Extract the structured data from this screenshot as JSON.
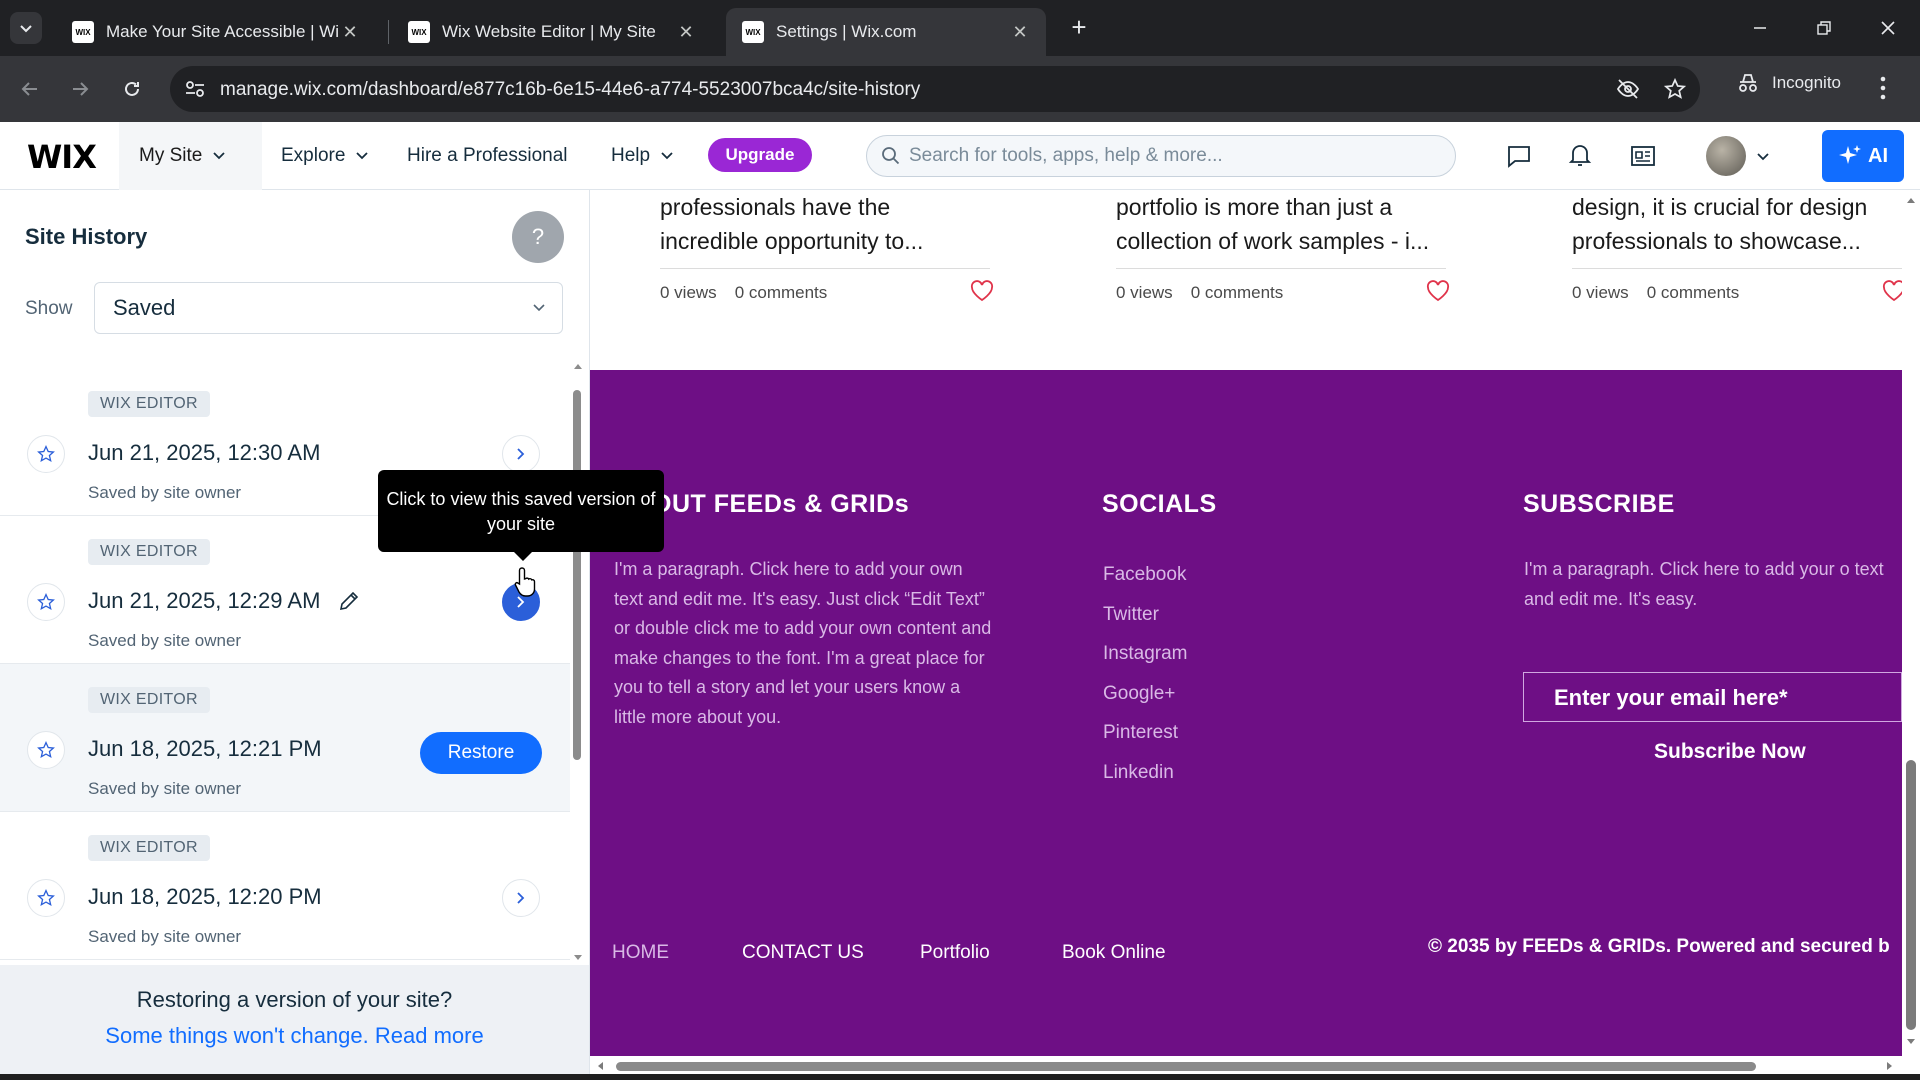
{
  "browser": {
    "tabs": [
      {
        "title": "Make Your Site Accessible | Wi",
        "favicon": "WIX"
      },
      {
        "title": "Wix Website Editor | My Site",
        "favicon": "WIX"
      },
      {
        "title": "Settings | Wix.com",
        "favicon": "WIX"
      }
    ],
    "url": "manage.wix.com/dashboard/e877c16b-6e15-44e6-a774-5523007bca4c/site-history",
    "incognito_label": "Incognito"
  },
  "header": {
    "logo": "WIX",
    "my_site": "My Site",
    "nav": [
      "Explore",
      "Hire a Professional",
      "Help"
    ],
    "upgrade": "Upgrade",
    "search_placeholder": "Search for tools, apps, help & more...",
    "ai_label": "AI"
  },
  "panel": {
    "title": "Site History",
    "help": "?",
    "show_label": "Show",
    "filter_value": "Saved",
    "items": [
      {
        "badge": "WIX EDITOR",
        "date": "Jun 21, 2025, 12:30 AM",
        "by": "Saved by site owner"
      },
      {
        "badge": "WIX EDITOR",
        "date": "Jun 21, 2025, 12:29 AM",
        "by": "Saved by site owner"
      },
      {
        "badge": "WIX EDITOR",
        "date": "Jun 18, 2025, 12:21 PM",
        "by": "Saved by site owner",
        "action": "Restore"
      },
      {
        "badge": "WIX EDITOR",
        "date": "Jun 18, 2025, 12:20 PM",
        "by": "Saved by site owner"
      }
    ],
    "tooltip": "Click to view this saved version of your site",
    "footer_question": "Restoring a version of your site?",
    "footer_link": "Some things won't change. Read more"
  },
  "preview": {
    "posts": [
      {
        "excerpt": "professionals have the incredible opportunity to...",
        "views": "0 views",
        "comments": "0 comments"
      },
      {
        "excerpt": "portfolio is more than just a collection of work samples - i...",
        "views": "0 views",
        "comments": "0 comments"
      },
      {
        "excerpt": "design, it is crucial for design professionals to showcase...",
        "views": "0 views",
        "comments": "0 comments"
      }
    ],
    "footer": {
      "about_heading": "OUT FEEDs & GRIDs",
      "about_text": "I'm a paragraph. Click here to add your own text and edit me. It's easy. Just click “Edit Text” or double click me to add your own content and make changes to the font. I'm a great place for you to tell a story and let your users know a little more about you.",
      "socials_heading": "SOCIALS",
      "socials": [
        "Facebook",
        "Twitter",
        "Instagram",
        "Google+",
        "Pinterest",
        "Linkedin"
      ],
      "subscribe_heading": "SUBSCRIBE",
      "subscribe_text": "I'm a paragraph. Click here to add your o text and edit me. It's easy.",
      "email_placeholder": "Enter your email here*",
      "subscribe_button": "Subscribe Now",
      "nav": [
        "HOME",
        "CONTACT US",
        "Portfolio",
        "Book Online"
      ],
      "copyright": "© 2035 by FEEDs & GRIDs. Powered and secured b"
    }
  },
  "colors": {
    "brand_blue": "#116dff",
    "upgrade_purple": "#9a27d5",
    "footer_purple": "#6e0f85"
  }
}
